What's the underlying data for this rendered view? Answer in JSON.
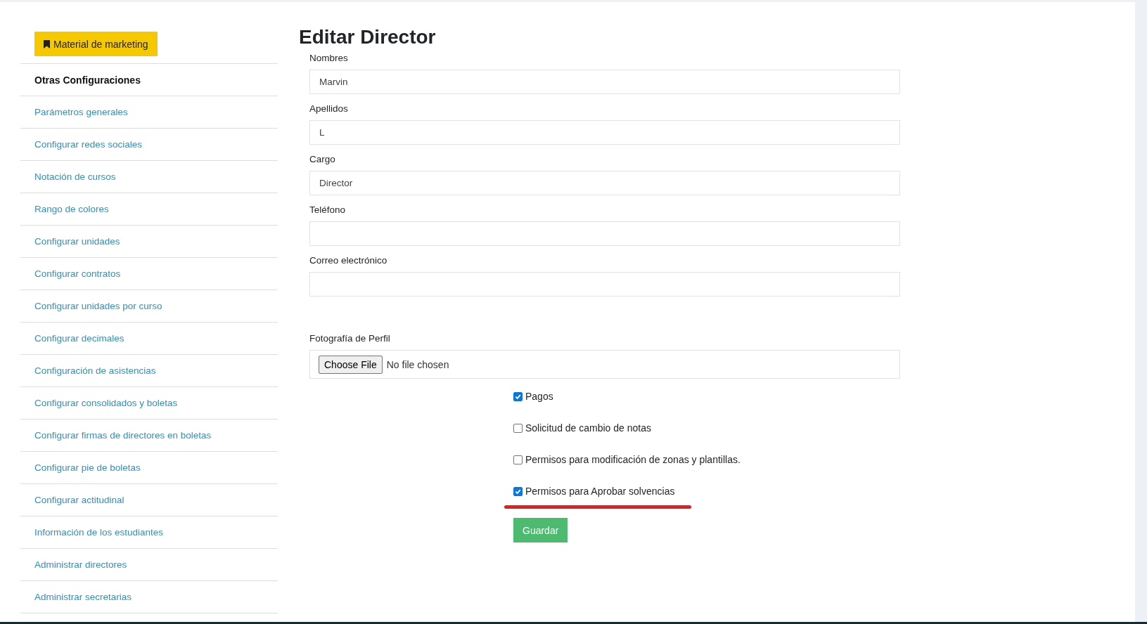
{
  "sidebar": {
    "button": "Material de marketing",
    "items": [
      {
        "label": "Otras Configuraciones",
        "kind": "header"
      },
      {
        "label": "Parámetros generales",
        "kind": "link"
      },
      {
        "label": "Configurar redes sociales",
        "kind": "link"
      },
      {
        "label": "Notación de cursos",
        "kind": "link"
      },
      {
        "label": "Rango de colores",
        "kind": "link"
      },
      {
        "label": "Configurar unidades",
        "kind": "link"
      },
      {
        "label": "Configurar contratos",
        "kind": "link"
      },
      {
        "label": "Configurar unidades por curso",
        "kind": "link"
      },
      {
        "label": "Configurar decimales",
        "kind": "link"
      },
      {
        "label": "Configuración de asistencias",
        "kind": "link"
      },
      {
        "label": "Configurar consolidados y boletas",
        "kind": "link"
      },
      {
        "label": "Configurar firmas de directores en boletas",
        "kind": "link"
      },
      {
        "label": "Configurar pie de boletas",
        "kind": "link"
      },
      {
        "label": "Configurar actitudinal",
        "kind": "link"
      },
      {
        "label": "Información de los estudiantes",
        "kind": "link"
      },
      {
        "label": "Administrar directores",
        "kind": "link"
      },
      {
        "label": "Administrar secretarias",
        "kind": "link"
      }
    ]
  },
  "form": {
    "title": "Editar Director",
    "fields": [
      {
        "label": "Nombres",
        "value": "Marvin"
      },
      {
        "label": "Apellidos",
        "value": "L"
      },
      {
        "label": "Cargo",
        "value": "Director"
      },
      {
        "label": "Teléfono"
      },
      {
        "label": "Correo electrónico"
      }
    ],
    "photo": {
      "label": "Fotografía de Perfil",
      "button": "Choose File",
      "status": "No file chosen"
    },
    "permissions": [
      {
        "label": "Pagos",
        "checked": true
      },
      {
        "label": "Solicitud de cambio de notas",
        "checked": false
      },
      {
        "label": "Permisos para modificación de zonas y plantillas.",
        "checked": false
      },
      {
        "label": "Permisos para Aprobar solvencias",
        "checked": true,
        "underlined": true
      }
    ],
    "submit": "Guardar"
  }
}
